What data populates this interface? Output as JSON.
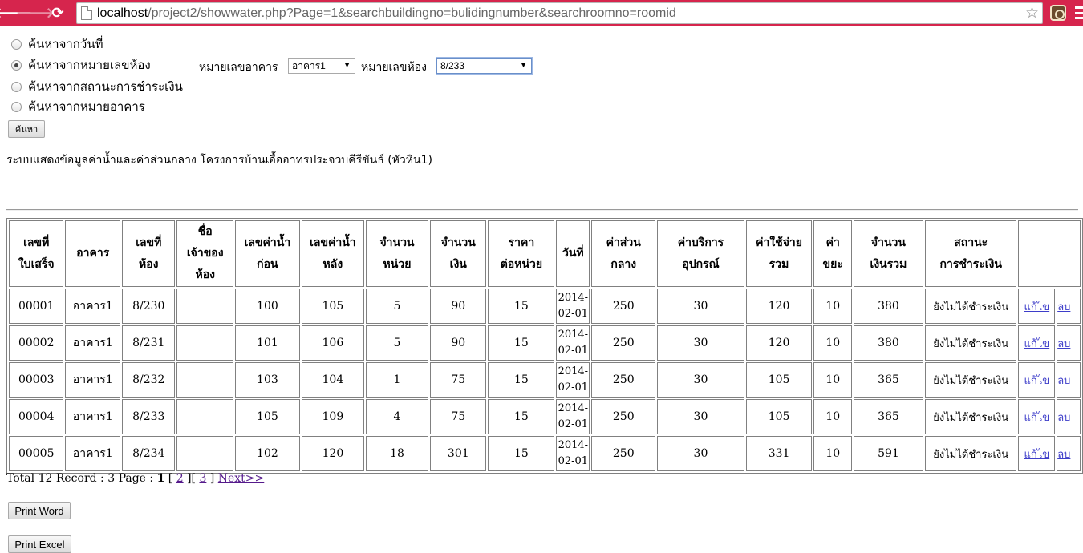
{
  "browser": {
    "url_host": "localhost",
    "url_rest": "/project2/showwater.php?Page=1&searchbuildingno=bulidingnumber&searchroomno=roomid"
  },
  "search": {
    "options": [
      {
        "label": "ค้นหาจากวันที่",
        "checked": false
      },
      {
        "label": "ค้นหาจากหมายเลขห้อง",
        "checked": true
      },
      {
        "label": "ค้นหาจากสถานะการชำระเงิน",
        "checked": false
      },
      {
        "label": "ค้นหาจากหมายอาคาร",
        "checked": false
      }
    ],
    "building_label": "หมายเลขอาคาร",
    "building_value": "อาคาร1",
    "room_label": "หมายเลขห้อง",
    "room_value": "8/233",
    "submit_label": "ค้นหา"
  },
  "caption": "ระบบแสดงข้อมูลค่าน้ำและค่าส่วนกลาง โครงการบ้านเอื้ออาทรประจวบคีรีขันธ์ (หัวหิน1)",
  "table": {
    "headers": [
      "เลขที่ ใบเสร็จ",
      "อาคาร",
      "เลขที่ ห้อง",
      "ชื่อ เจ้าของห้อง",
      "เลขค่าน้ำ ก่อน",
      "เลขค่าน้ำ หลัง",
      "จำนวน หน่วย",
      "จำนวน เงิน",
      "ราคา ต่อหน่วย",
      "วันที่",
      "ค่าส่วน กลาง",
      "ค่าบริการ อุปกรณ์",
      "ค่าใช้จ่าย รวม",
      "ค่า ขยะ",
      "จำนวน เงินรวม",
      "สถานะ การชำระเงิน",
      ""
    ],
    "rows": [
      {
        "receipt": "00001",
        "building": "อาคาร1",
        "room": "8/230",
        "owner": "",
        "before": "100",
        "after": "105",
        "units": "5",
        "amount": "90",
        "price": "15",
        "date": "2014-02-01",
        "common": "250",
        "service": "30",
        "total_cost": "120",
        "garbage": "10",
        "grand_total": "380",
        "status": "ยังไม่ได้ชำระเงิน",
        "edit": "แก้ไข",
        "delete": "ลบ"
      },
      {
        "receipt": "00002",
        "building": "อาคาร1",
        "room": "8/231",
        "owner": "",
        "before": "101",
        "after": "106",
        "units": "5",
        "amount": "90",
        "price": "15",
        "date": "2014-02-01",
        "common": "250",
        "service": "30",
        "total_cost": "120",
        "garbage": "10",
        "grand_total": "380",
        "status": "ยังไม่ได้ชำระเงิน",
        "edit": "แก้ไข",
        "delete": "ลบ"
      },
      {
        "receipt": "00003",
        "building": "อาคาร1",
        "room": "8/232",
        "owner": "",
        "before": "103",
        "after": "104",
        "units": "1",
        "amount": "75",
        "price": "15",
        "date": "2014-02-01",
        "common": "250",
        "service": "30",
        "total_cost": "105",
        "garbage": "10",
        "grand_total": "365",
        "status": "ยังไม่ได้ชำระเงิน",
        "edit": "แก้ไข",
        "delete": "ลบ"
      },
      {
        "receipt": "00004",
        "building": "อาคาร1",
        "room": "8/233",
        "owner": "",
        "before": "105",
        "after": "109",
        "units": "4",
        "amount": "75",
        "price": "15",
        "date": "2014-02-01",
        "common": "250",
        "service": "30",
        "total_cost": "105",
        "garbage": "10",
        "grand_total": "365",
        "status": "ยังไม่ได้ชำระเงิน",
        "edit": "แก้ไข",
        "delete": "ลบ"
      },
      {
        "receipt": "00005",
        "building": "อาคาร1",
        "room": "8/234",
        "owner": "",
        "before": "102",
        "after": "120",
        "units": "18",
        "amount": "301",
        "price": "15",
        "date": "2014-02-01",
        "common": "250",
        "service": "30",
        "total_cost": "331",
        "garbage": "10",
        "grand_total": "591",
        "status": "ยังไม่ได้ชำระเงิน",
        "edit": "แก้ไข",
        "delete": "ลบ"
      }
    ]
  },
  "pager": {
    "prefix": "Total 12 Record : 3 Page :",
    "current": "1",
    "page2": "2",
    "page3": "3",
    "next": "Next>>"
  },
  "actions": {
    "print_word": "Print Word",
    "print_excel": "Print Excel"
  }
}
